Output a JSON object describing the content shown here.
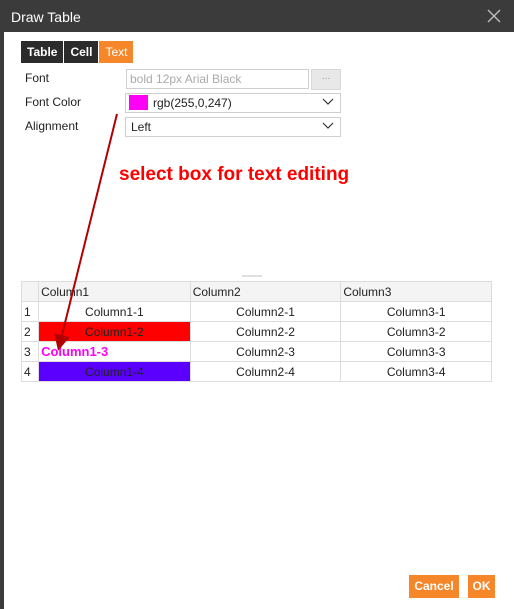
{
  "dialog": {
    "title": "Draw Table",
    "tabs": [
      {
        "label": "Table"
      },
      {
        "label": "Cell"
      },
      {
        "label": "Text"
      }
    ],
    "active_tab": "Text"
  },
  "form": {
    "font_label": "Font",
    "font_value": "bold 12px Arial Black",
    "font_button": "...",
    "font_color_label": "Font Color",
    "font_color_value": "rgb(255,0,247)",
    "font_color_hex": "#ff00f7",
    "alignment_label": "Alignment",
    "alignment_value": "Left"
  },
  "annotation": {
    "text": "select box for text editing",
    "color": "#ff0000"
  },
  "grid": {
    "headers": [
      "",
      "Column1",
      "Column2",
      "Column3"
    ],
    "rows": [
      {
        "num": "1",
        "c1": "Column1-1",
        "c2": "Column2-1",
        "c3": "Column3-1"
      },
      {
        "num": "2",
        "c1": "Column1-2",
        "c2": "Column2-2",
        "c3": "Column3-2"
      },
      {
        "num": "3",
        "c1": "Column1-3",
        "c2": "Column2-3",
        "c3": "Column3-3"
      },
      {
        "num": "4",
        "c1": "Column1-4",
        "c2": "Column2-4",
        "c3": "Column3-4"
      }
    ]
  },
  "buttons": {
    "cancel": "Cancel",
    "ok": "OK"
  },
  "colors": {
    "accent": "#f5862a",
    "titlebar": "#3b3b3b",
    "cell_red": "#ff0000",
    "cell_purple": "#5b00ff"
  }
}
